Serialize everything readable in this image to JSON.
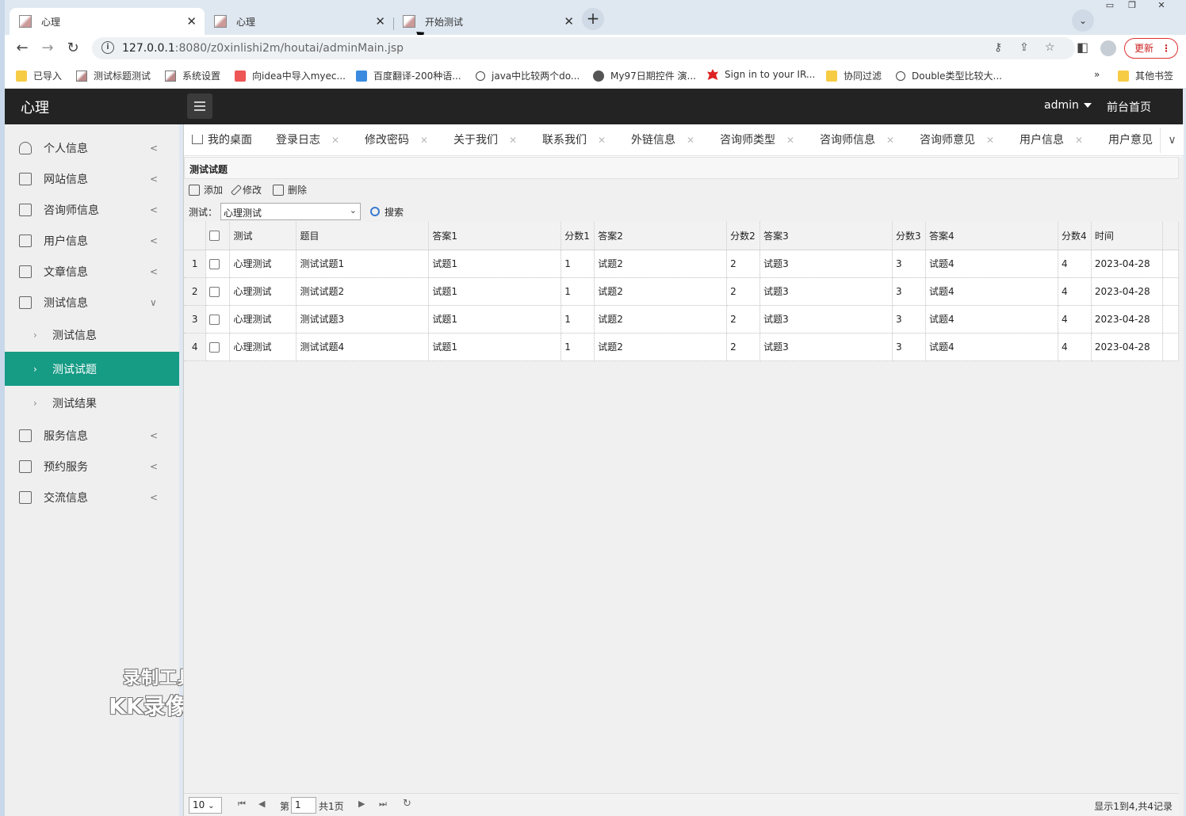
{
  "browser": {
    "tabs": [
      {
        "label": "心理",
        "active": true
      },
      {
        "label": "心理",
        "active": false
      },
      {
        "label": "开始测试",
        "active": false
      }
    ],
    "new_tab": "+",
    "url_host": "127.0.0.1",
    "url_rest": ":8080/z0xinlishi2m/houtai/adminMain.jsp",
    "update_label": "更新",
    "bookmarks": [
      {
        "label": "已导入",
        "icon": "folder"
      },
      {
        "label": "测试标题测试",
        "icon": "img"
      },
      {
        "label": "系统设置",
        "icon": "img"
      },
      {
        "label": "向idea中导入myec...",
        "icon": "red"
      },
      {
        "label": "百度翻译-200种语...",
        "icon": "blue"
      },
      {
        "label": "java中比较两个do...",
        "icon": "fly"
      },
      {
        "label": "My97日期控件 演...",
        "icon": "globe"
      },
      {
        "label": "Sign in to your IR...",
        "icon": "leaf"
      },
      {
        "label": "协同过滤",
        "icon": "folder"
      },
      {
        "label": "Double类型比较大...",
        "icon": "fly"
      }
    ],
    "more_bookmarks": "»",
    "other_bookmarks": "其他书签"
  },
  "app": {
    "logo": "心理",
    "user": "admin",
    "home_link": "前台首页"
  },
  "sidebar": {
    "items": [
      {
        "label": "个人信息",
        "arrow": "<"
      },
      {
        "label": "网站信息",
        "arrow": "<"
      },
      {
        "label": "咨询师信息",
        "arrow": "<"
      },
      {
        "label": "用户信息",
        "arrow": "<"
      },
      {
        "label": "文章信息",
        "arrow": "<"
      },
      {
        "label": "测试信息",
        "arrow": "∨"
      }
    ],
    "subitems": [
      {
        "label": "测试信息",
        "active": false
      },
      {
        "label": "测试试题",
        "active": true
      },
      {
        "label": "测试结果",
        "active": false
      }
    ],
    "items_after": [
      {
        "label": "服务信息",
        "arrow": "<"
      },
      {
        "label": "预约服务",
        "arrow": "<"
      },
      {
        "label": "交流信息",
        "arrow": "<"
      }
    ]
  },
  "watermark": {
    "line1": "录制工具",
    "line2": "KK录像机"
  },
  "page_tabs": [
    "我的桌面",
    "登录日志",
    "修改密码",
    "关于我们",
    "联系我们",
    "外链信息",
    "咨询师类型",
    "咨询师信息",
    "咨询师意见",
    "用户信息",
    "用户意见"
  ],
  "panel": {
    "title": "测试试题",
    "add": "添加",
    "edit": "修改",
    "delete": "删除",
    "filter_label": "测试：",
    "filter_value": "心理测试",
    "search": "搜索"
  },
  "table": {
    "columns": [
      "测试",
      "题目",
      "答案1",
      "分数1",
      "答案2",
      "分数2",
      "答案3",
      "分数3",
      "答案4",
      "分数4",
      "时间"
    ],
    "rows": [
      [
        "1",
        "心理测试",
        "测试试题1",
        "试题1",
        "1",
        "试题2",
        "2",
        "试题3",
        "3",
        "试题4",
        "4",
        "2023-04-28"
      ],
      [
        "2",
        "心理测试",
        "测试试题2",
        "试题1",
        "1",
        "试题2",
        "2",
        "试题3",
        "3",
        "试题4",
        "4",
        "2023-04-28"
      ],
      [
        "3",
        "心理测试",
        "测试试题3",
        "试题1",
        "1",
        "试题2",
        "2",
        "试题3",
        "3",
        "试题4",
        "4",
        "2023-04-28"
      ],
      [
        "4",
        "心理测试",
        "测试试题4",
        "试题1",
        "1",
        "试题2",
        "2",
        "试题3",
        "3",
        "试题4",
        "4",
        "2023-04-28"
      ]
    ]
  },
  "pager": {
    "page_size": "10",
    "page_prefix": "第",
    "page_value": "1",
    "page_total": "共1页",
    "info": "显示1到4,共4记录"
  }
}
